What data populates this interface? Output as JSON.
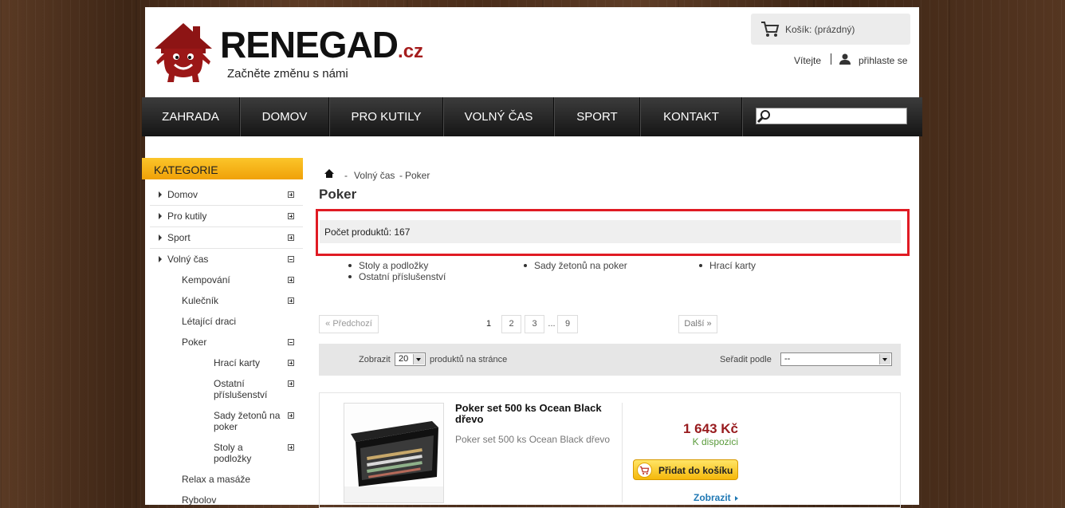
{
  "header": {
    "logo_name": "RENEGAD",
    "logo_tld": ".cz",
    "slogan": "Začněte změnu s námi",
    "cart_label": "Košík: (prázdný)",
    "welcome": "Vítejte",
    "login": "přihlaste se"
  },
  "nav": {
    "items": [
      "ZAHRADA",
      "DOMOV",
      "PRO KUTILY",
      "VOLNÝ ČAS",
      "SPORT",
      "KONTAKT"
    ],
    "search_placeholder": ""
  },
  "sidebar": {
    "title": "KATEGORIE",
    "items": [
      {
        "label": "Domov",
        "state": "plus"
      },
      {
        "label": "Pro kutily",
        "state": "plus"
      },
      {
        "label": "Sport",
        "state": "plus"
      },
      {
        "label": "Volný čas",
        "state": "minus"
      },
      {
        "label": "Kempování",
        "state": "plus"
      },
      {
        "label": "Kulečník",
        "state": "plus"
      },
      {
        "label": "Létající draci",
        "state": "none"
      },
      {
        "label": "Poker",
        "state": "minus"
      },
      {
        "label": "Hrací karty",
        "state": "plus"
      },
      {
        "label": "Ostatní příslušenství",
        "state": "plus"
      },
      {
        "label": "Sady žetonů na poker",
        "state": "plus"
      },
      {
        "label": "Stoly a podložky",
        "state": "plus"
      },
      {
        "label": "Relax a masáže",
        "state": "none"
      },
      {
        "label": "Rybolov",
        "state": "none"
      }
    ]
  },
  "breadcrumb": {
    "sep1": "-",
    "level1": "Volný čas",
    "sep2": "-",
    "level2": "Poker"
  },
  "main": {
    "title": "Poker",
    "count_text": "Počet produktů: 167",
    "subcategories": [
      "Stoly a podložky",
      "Sady žetonů na poker",
      "Hrací karty",
      "Ostatní příslušenství"
    ]
  },
  "pagination": {
    "prev": "« Předchozí",
    "pages": [
      "1",
      "2",
      "3"
    ],
    "ellipsis": "...",
    "last": "9",
    "next": "Další »",
    "current": "1"
  },
  "toolbar": {
    "show_label": "Zobrazit",
    "per_page": "20",
    "per_page_suffix": "produktů na stránce",
    "sort_label": "Seřadit podle",
    "sort_value": "--"
  },
  "product": {
    "name": "Poker set 500 ks Ocean Black dřevo",
    "desc": "Poker set 500 ks Ocean Black dřevo",
    "price": "1 643 Kč",
    "availability": "K dispozici",
    "add_to_cart": "Přidat do košíku",
    "detail": "Zobrazit"
  },
  "colors": {
    "accent": "#f5b80b",
    "price": "#981b1e",
    "available": "#5a9b3b",
    "highlight_frame": "#e01b24"
  }
}
